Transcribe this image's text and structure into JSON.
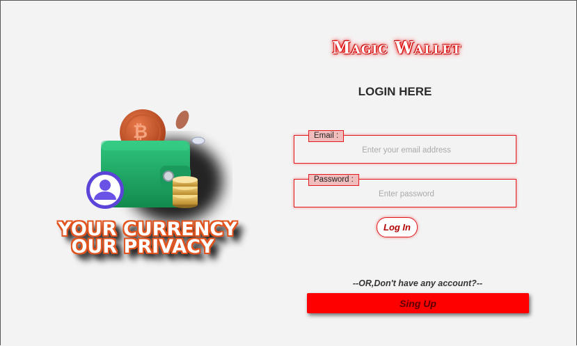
{
  "hero": {
    "slogan_line1": "YOUR CURRENCY",
    "slogan_line2": "OUR PRIVACY",
    "coin_symbol": "₿"
  },
  "brand": {
    "name": "Magic Wallet"
  },
  "login": {
    "title": "LOGIN HERE",
    "email_label": "Email :",
    "email_placeholder": "Enter your email address",
    "password_label": "Password :",
    "password_placeholder": "Enter password",
    "login_button": "Log In",
    "or_text": "--OR,Don't have any account?--",
    "signup_button": "Sing Up"
  },
  "colors": {
    "accent_red": "#e1191f",
    "signup_bg": "#ff0000",
    "wallet_green": "#1fae6a",
    "coin_orange": "#d2572b",
    "slogan_orange": "#e2531e"
  }
}
